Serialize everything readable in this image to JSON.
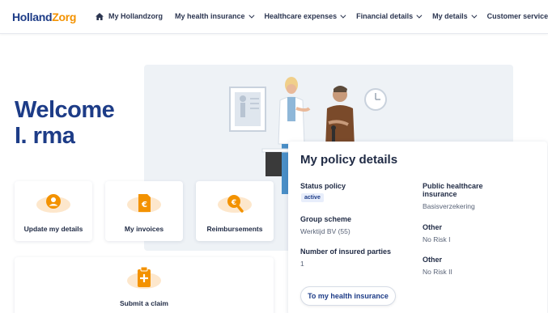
{
  "brand": {
    "part1": "Holland",
    "part2": "Zorg",
    "primary_color": "#1d3c87",
    "accent_color": "#f39200"
  },
  "nav": {
    "home_icon": "home-icon",
    "items": [
      {
        "label": "My Hollandzorg",
        "dropdown": false
      },
      {
        "label": "My health insurance",
        "dropdown": true
      },
      {
        "label": "Healthcare expenses",
        "dropdown": true
      },
      {
        "label": "Financial details",
        "dropdown": true
      },
      {
        "label": "My details",
        "dropdown": true
      },
      {
        "label": "Customer services",
        "dropdown": false
      }
    ]
  },
  "welcome": {
    "line1": "Welcome",
    "line2": "I. rma"
  },
  "tiles": [
    {
      "label": "Update my details",
      "icon": "user-icon"
    },
    {
      "label": "My invoices",
      "icon": "invoice-icon"
    },
    {
      "label": "Reimbursements",
      "icon": "euro-search-icon"
    },
    {
      "label": "Submit a claim",
      "icon": "clipboard-plus-icon"
    }
  ],
  "policy": {
    "title": "My policy details",
    "status_label": "Status policy",
    "status_badge": "active",
    "group_label": "Group scheme",
    "group_value": "Werktijd BV (55)",
    "insured_label": "Number of insured parties",
    "insured_value": "1",
    "public_label_line1": "Public healthcare",
    "public_label_line2": "insurance",
    "public_value": "Basisverzekering",
    "other1_label": "Other",
    "other1_value": "No Risk I",
    "other2_label": "Other",
    "other2_value": "No Risk II",
    "button_label": "To my health insurance"
  }
}
